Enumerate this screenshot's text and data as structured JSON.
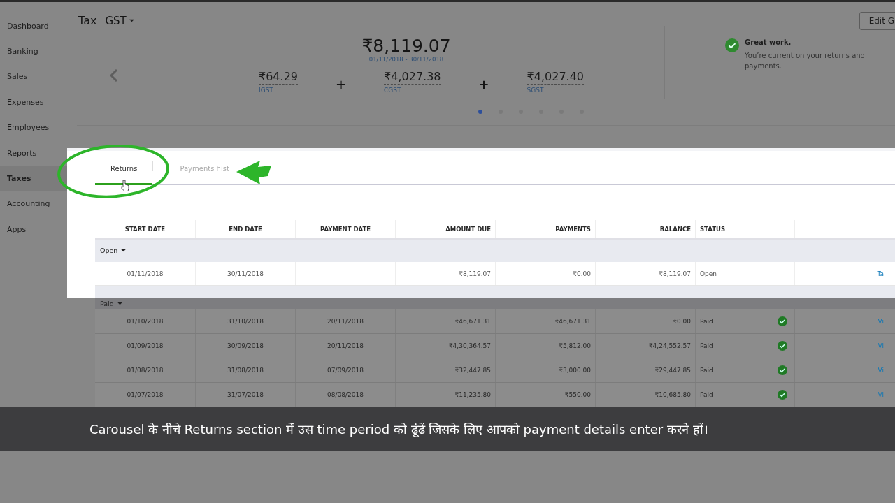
{
  "sidebar": {
    "items": [
      {
        "label": "Dashboard",
        "selected": false
      },
      {
        "label": "Banking",
        "selected": false
      },
      {
        "label": "Sales",
        "selected": false
      },
      {
        "label": "Expenses",
        "selected": false
      },
      {
        "label": "Employees",
        "selected": false
      },
      {
        "label": "Reports",
        "selected": false
      },
      {
        "label": "Taxes",
        "selected": true
      },
      {
        "label": "Accounting",
        "selected": false
      },
      {
        "label": "Apps",
        "selected": false
      }
    ]
  },
  "header": {
    "title": "Tax",
    "selector": "GST",
    "edit_button": "Edit G"
  },
  "carousel": {
    "total": "₹8,119.07",
    "period": "01/11/2018 - 30/11/2018",
    "components": [
      {
        "amount": "₹64.29",
        "label": "IGST"
      },
      {
        "amount": "₹4,027.38",
        "label": "CGST"
      },
      {
        "amount": "₹4,027.40",
        "label": "SGST"
      }
    ],
    "operators": [
      "+",
      "+"
    ],
    "pages": [
      {
        "selected": true
      },
      {
        "selected": false
      },
      {
        "selected": false
      },
      {
        "selected": false
      },
      {
        "selected": false
      },
      {
        "selected": false
      }
    ]
  },
  "status_message": {
    "title": "Great work.",
    "text": "You’re current on your returns and payments."
  },
  "tabs": [
    {
      "label": "Returns",
      "selected": true
    },
    {
      "label": "Payments hist",
      "selected": false
    }
  ],
  "table": {
    "columns": [
      "START DATE",
      "END DATE",
      "PAYMENT DATE",
      "AMOUNT DUE",
      "PAYMENTS",
      "BALANCE",
      "STATUS"
    ],
    "groups": [
      {
        "label": "Open",
        "expanded": true,
        "rows": [
          {
            "cells": [
              "01/11/2018",
              "30/11/2018",
              "",
              "₹8,119.07",
              "₹0.00",
              "₹8,119.07",
              "Open"
            ],
            "checked": false,
            "action": "Ta"
          }
        ]
      },
      {
        "label": "Paid",
        "expanded": true,
        "rows": [
          {
            "cells": [
              "01/10/2018",
              "31/10/2018",
              "20/11/2018",
              "₹46,671.31",
              "₹46,671.31",
              "₹0.00",
              "Paid"
            ],
            "checked": true,
            "action": "Vi"
          },
          {
            "cells": [
              "01/09/2018",
              "30/09/2018",
              "20/11/2018",
              "₹4,30,364.57",
              "₹5,812.00",
              "₹4,24,552.57",
              "Paid"
            ],
            "checked": true,
            "action": "Vi"
          },
          {
            "cells": [
              "01/08/2018",
              "31/08/2018",
              "07/09/2018",
              "₹32,447.85",
              "₹3,000.00",
              "₹29,447.85",
              "Paid"
            ],
            "checked": true,
            "action": "Vi"
          },
          {
            "cells": [
              "01/07/2018",
              "31/07/2018",
              "08/08/2018",
              "₹11,235.80",
              "₹550.00",
              "₹10,685.80",
              "Paid"
            ],
            "checked": true,
            "action": "Vi"
          }
        ]
      }
    ]
  },
  "caption": "Carousel के नीचे Returns section में उस time period को ढूंढें जिसके लिए आपको payment details enter करने हों।"
}
